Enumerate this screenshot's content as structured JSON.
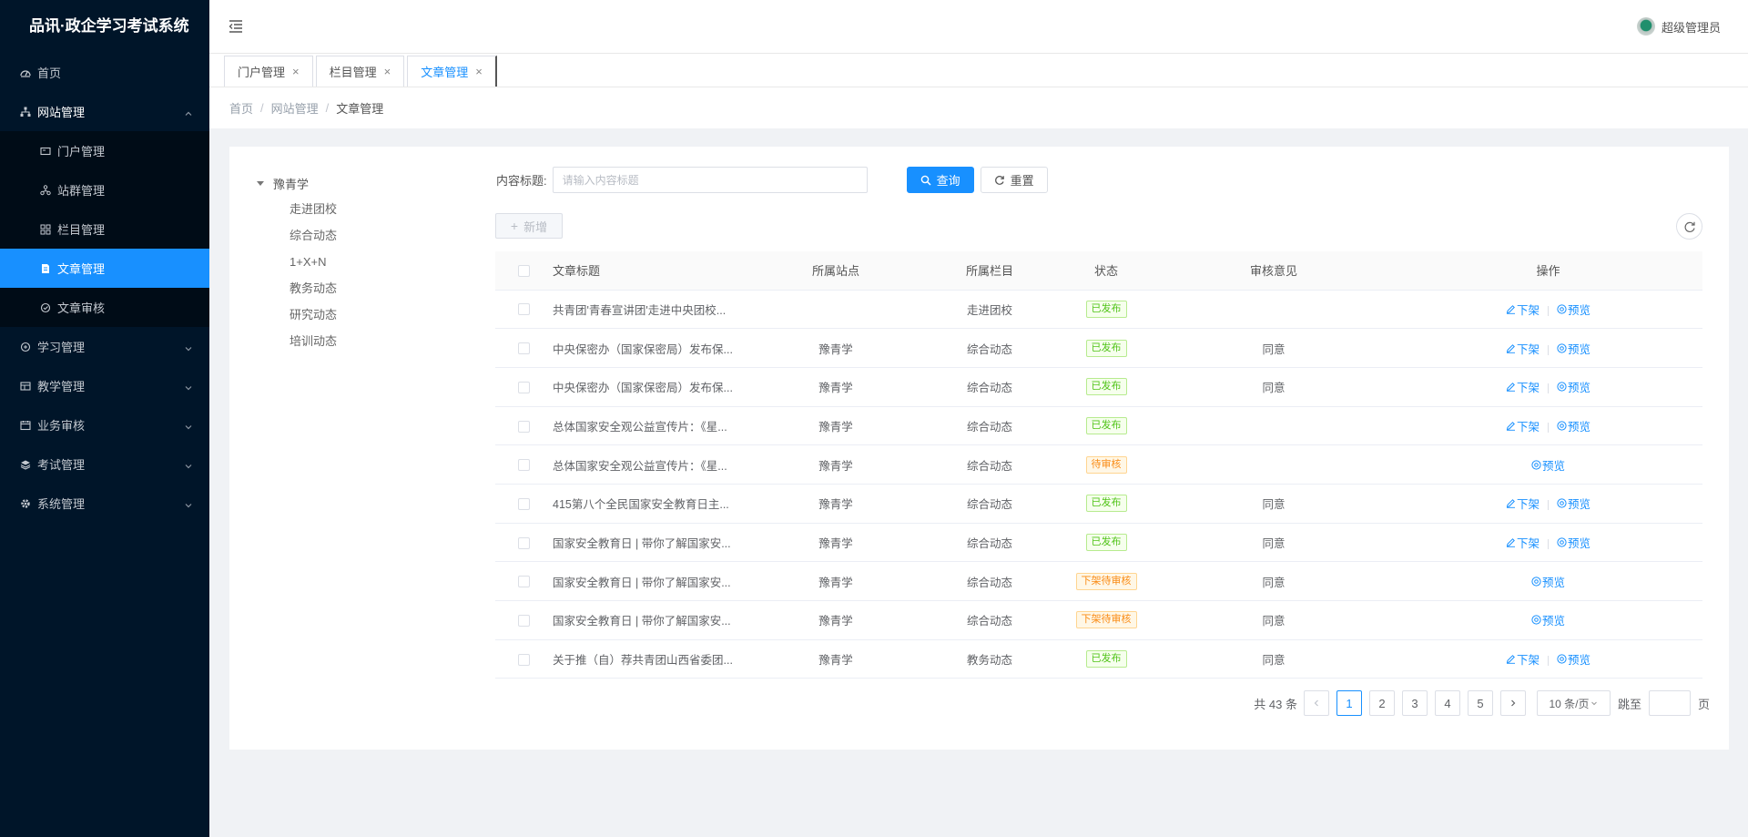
{
  "app": {
    "title": "品讯·政企学习考试系统"
  },
  "sidebar": {
    "items": [
      {
        "label": "首页",
        "icon": "dashboard-icon"
      },
      {
        "label": "网站管理",
        "icon": "network-icon",
        "expanded": true,
        "children": [
          {
            "label": "门户管理",
            "icon": "portal-icon"
          },
          {
            "label": "站群管理",
            "icon": "sitegroup-icon"
          },
          {
            "label": "栏目管理",
            "icon": "columns-icon"
          },
          {
            "label": "文章管理",
            "icon": "article-icon",
            "active": true
          },
          {
            "label": "文章审核",
            "icon": "review-icon"
          }
        ]
      },
      {
        "label": "学习管理",
        "icon": "study-icon"
      },
      {
        "label": "教学管理",
        "icon": "teaching-icon"
      },
      {
        "label": "业务审核",
        "icon": "audit-icon"
      },
      {
        "label": "考试管理",
        "icon": "exam-icon"
      },
      {
        "label": "系统管理",
        "icon": "settings-icon"
      }
    ]
  },
  "header": {
    "user": "超级管理员"
  },
  "tabs": [
    {
      "label": "门户管理"
    },
    {
      "label": "栏目管理"
    },
    {
      "label": "文章管理",
      "active": true
    }
  ],
  "breadcrumb": [
    "首页",
    "网站管理",
    "文章管理"
  ],
  "tree": {
    "root": "豫青学",
    "children": [
      "走进团校",
      "综合动态",
      "1+X+N",
      "教务动态",
      "研究动态",
      "培训动态"
    ]
  },
  "search": {
    "label": "内容标题:",
    "placeholder": "请输入内容标题",
    "query_label": "查询",
    "reset_label": "重置"
  },
  "toolbar": {
    "add_label": "新增"
  },
  "table": {
    "headers": {
      "title": "文章标题",
      "site": "所属站点",
      "column": "所属栏目",
      "status": "状态",
      "opinion": "审核意见",
      "action": "操作"
    },
    "actions": {
      "offline": "下架",
      "preview": "预览"
    },
    "rows": [
      {
        "title": "共青团'青春宣讲团'走进中央团校...",
        "site": "",
        "column": "走进团校",
        "status": "已发布",
        "status_type": "green",
        "opinion": "",
        "offline": true
      },
      {
        "title": "中央保密办（国家保密局）发布保...",
        "site": "豫青学",
        "column": "综合动态",
        "status": "已发布",
        "status_type": "green",
        "opinion": "同意",
        "offline": true
      },
      {
        "title": "中央保密办（国家保密局）发布保...",
        "site": "豫青学",
        "column": "综合动态",
        "status": "已发布",
        "status_type": "green",
        "opinion": "同意",
        "offline": true
      },
      {
        "title": "总体国家安全观公益宣传片：《星...",
        "site": "豫青学",
        "column": "综合动态",
        "status": "已发布",
        "status_type": "green",
        "opinion": "",
        "offline": true
      },
      {
        "title": "总体国家安全观公益宣传片：《星...",
        "site": "豫青学",
        "column": "综合动态",
        "status": "待审核",
        "status_type": "orange",
        "opinion": "",
        "offline": false
      },
      {
        "title": "415第八个全民国家安全教育日主...",
        "site": "豫青学",
        "column": "综合动态",
        "status": "已发布",
        "status_type": "green",
        "opinion": "同意",
        "offline": true
      },
      {
        "title": "国家安全教育日 | 带你了解国家安...",
        "site": "豫青学",
        "column": "综合动态",
        "status": "已发布",
        "status_type": "green",
        "opinion": "同意",
        "offline": true
      },
      {
        "title": "国家安全教育日 | 带你了解国家安...",
        "site": "豫青学",
        "column": "综合动态",
        "status": "下架待审核",
        "status_type": "orange",
        "opinion": "同意",
        "offline": false
      },
      {
        "title": "国家安全教育日 | 带你了解国家安...",
        "site": "豫青学",
        "column": "综合动态",
        "status": "下架待审核",
        "status_type": "orange",
        "opinion": "同意",
        "offline": false
      },
      {
        "title": "关于推（自）荐共青团山西省委团...",
        "site": "豫青学",
        "column": "教务动态",
        "status": "已发布",
        "status_type": "green",
        "opinion": "同意",
        "offline": true
      }
    ]
  },
  "pagination": {
    "total_text": "共 43 条",
    "pages": [
      "1",
      "2",
      "3",
      "4",
      "5"
    ],
    "current": "1",
    "page_size": "10 条/页",
    "jump_prefix": "跳至",
    "jump_suffix": "页"
  },
  "colors": {
    "primary": "#1890ff",
    "sidebar": "#001529",
    "submenu": "#000c17",
    "success": "#52c41a",
    "warning": "#fa8c16"
  }
}
